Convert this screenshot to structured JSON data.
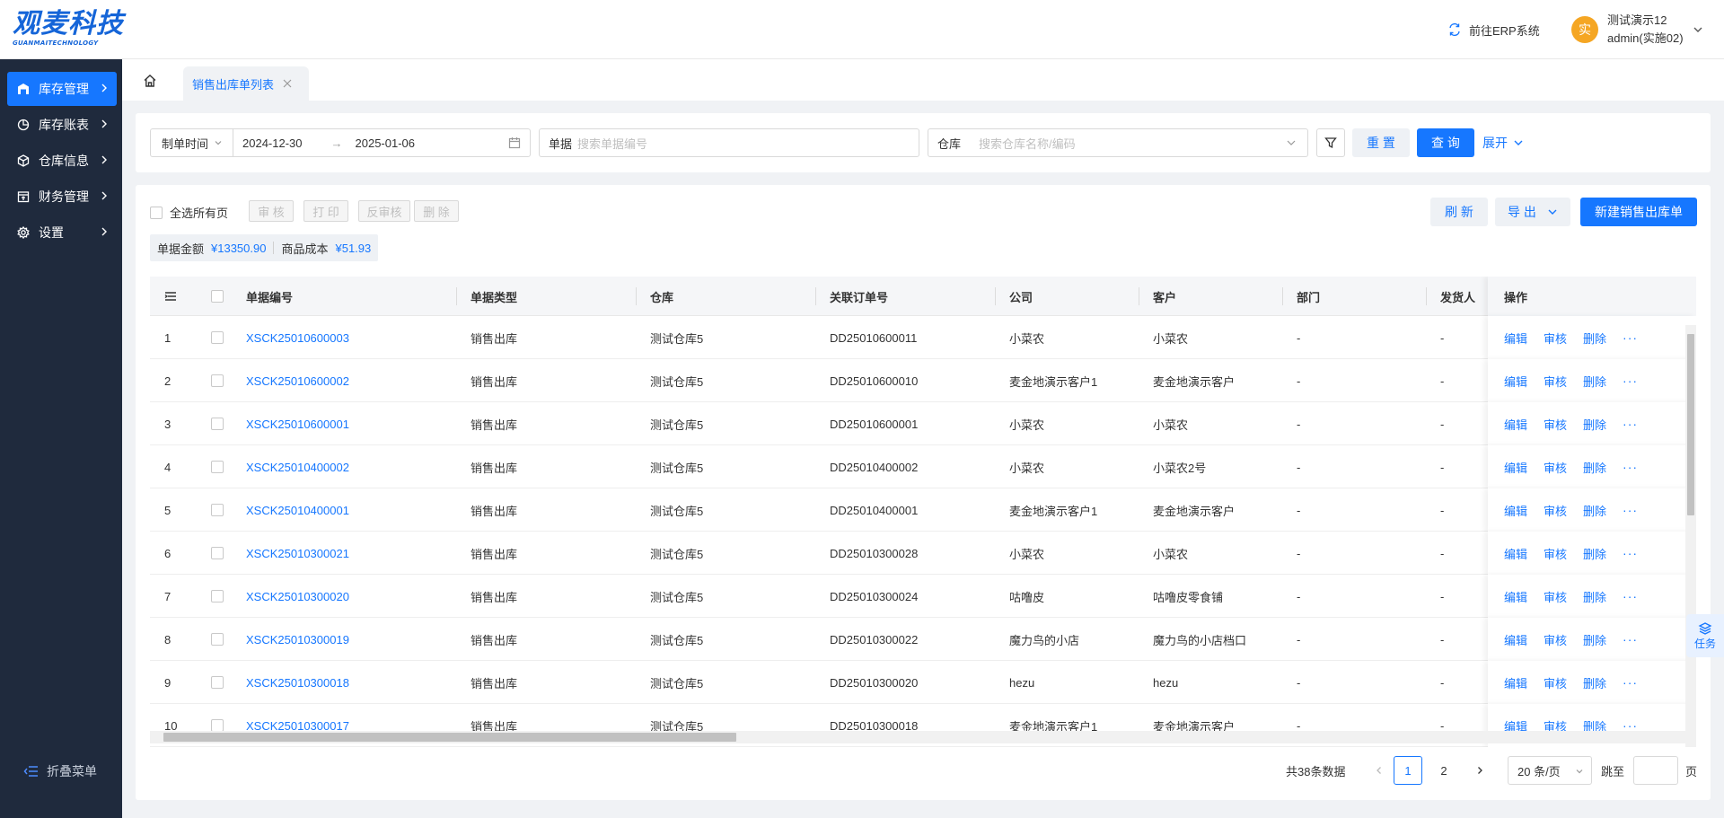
{
  "header": {
    "logo_main": "观麦科技",
    "logo_sub": "GUANMAITECHNOLOGY",
    "erp_link": "前往ERP系统",
    "avatar_char": "实",
    "user_name": "测试演示12",
    "user_account": "admin(实施02)"
  },
  "sidebar": {
    "items": [
      {
        "label": "库存管理",
        "icon": "warehouse-icon"
      },
      {
        "label": "库存账表",
        "icon": "chart-pie-icon"
      },
      {
        "label": "仓库信息",
        "icon": "box-icon"
      },
      {
        "label": "财务管理",
        "icon": "wallet-icon"
      },
      {
        "label": "设置",
        "icon": "gear-icon"
      }
    ],
    "collapse_label": "折叠菜单"
  },
  "tabs": {
    "active_label": "销售出库单列表"
  },
  "filter": {
    "date_type": "制单时间",
    "date_start": "2024-12-30",
    "date_sep": "→",
    "date_end": "2025-01-06",
    "doc_label": "单据",
    "doc_placeholder": "搜索单据编号",
    "warehouse_label": "仓库",
    "warehouse_placeholder": "搜索仓库名称/编码",
    "reset_label": "重 置",
    "query_label": "查 询",
    "expand_label": "展开"
  },
  "toolbar": {
    "select_all": "全选所有页",
    "audit": "审 核",
    "print": "打 印",
    "unaudit": "反审核",
    "delete": "删 除",
    "refresh": "刷 新",
    "export": "导 出",
    "create": "新建销售出库单"
  },
  "summary": {
    "amount_label": "单据金额",
    "amount_value": "¥13350.90",
    "cost_label": "商品成本",
    "cost_value": "¥51.93"
  },
  "table": {
    "headers": {
      "doc_no": "单据编号",
      "doc_type": "单据类型",
      "warehouse": "仓库",
      "order_no": "关联订单号",
      "company": "公司",
      "customer": "客户",
      "department": "部门",
      "shipper": "发货人",
      "actions": "操作"
    },
    "row_actions": {
      "edit": "编辑",
      "audit": "审核",
      "delete": "删除",
      "more": "···"
    },
    "rows": [
      {
        "idx": "1",
        "doc_no": "XSCK25010600003",
        "doc_type": "销售出库",
        "warehouse": "测试仓库5",
        "order_no": "DD25010600011",
        "company": "小菜农",
        "customer": "小菜农",
        "department": "-",
        "shipper": "-"
      },
      {
        "idx": "2",
        "doc_no": "XSCK25010600002",
        "doc_type": "销售出库",
        "warehouse": "测试仓库5",
        "order_no": "DD25010600010",
        "company": "麦金地演示客户1",
        "customer": "麦金地演示客户",
        "department": "-",
        "shipper": "-"
      },
      {
        "idx": "3",
        "doc_no": "XSCK25010600001",
        "doc_type": "销售出库",
        "warehouse": "测试仓库5",
        "order_no": "DD25010600001",
        "company": "小菜农",
        "customer": "小菜农",
        "department": "-",
        "shipper": "-"
      },
      {
        "idx": "4",
        "doc_no": "XSCK25010400002",
        "doc_type": "销售出库",
        "warehouse": "测试仓库5",
        "order_no": "DD25010400002",
        "company": "小菜农",
        "customer": "小菜农2号",
        "department": "-",
        "shipper": "-"
      },
      {
        "idx": "5",
        "doc_no": "XSCK25010400001",
        "doc_type": "销售出库",
        "warehouse": "测试仓库5",
        "order_no": "DD25010400001",
        "company": "麦金地演示客户1",
        "customer": "麦金地演示客户",
        "department": "-",
        "shipper": "-"
      },
      {
        "idx": "6",
        "doc_no": "XSCK25010300021",
        "doc_type": "销售出库",
        "warehouse": "测试仓库5",
        "order_no": "DD25010300028",
        "company": "小菜农",
        "customer": "小菜农",
        "department": "-",
        "shipper": "-"
      },
      {
        "idx": "7",
        "doc_no": "XSCK25010300020",
        "doc_type": "销售出库",
        "warehouse": "测试仓库5",
        "order_no": "DD25010300024",
        "company": "咕噜皮",
        "customer": "咕噜皮零食铺",
        "department": "-",
        "shipper": "-"
      },
      {
        "idx": "8",
        "doc_no": "XSCK25010300019",
        "doc_type": "销售出库",
        "warehouse": "测试仓库5",
        "order_no": "DD25010300022",
        "company": "魔力鸟的小店",
        "customer": "魔力鸟的小店档口",
        "department": "-",
        "shipper": "-"
      },
      {
        "idx": "9",
        "doc_no": "XSCK25010300018",
        "doc_type": "销售出库",
        "warehouse": "测试仓库5",
        "order_no": "DD25010300020",
        "company": "hezu",
        "customer": "hezu",
        "department": "-",
        "shipper": "-"
      },
      {
        "idx": "10",
        "doc_no": "XSCK25010300017",
        "doc_type": "销售出库",
        "warehouse": "测试仓库5",
        "order_no": "DD25010300018",
        "company": "麦金地演示客户1",
        "customer": "麦金地演示客户",
        "department": "-",
        "shipper": "-"
      }
    ]
  },
  "pagination": {
    "total": "共38条数据",
    "pages": [
      "1",
      "2"
    ],
    "page_size": "20 条/页",
    "jump_label": "跳至",
    "page_unit": "页"
  },
  "task_float": {
    "label": "任务"
  },
  "colors": {
    "primary": "#1677ff",
    "sidebar": "#1f2a3d",
    "avatar": "#f5a623"
  }
}
